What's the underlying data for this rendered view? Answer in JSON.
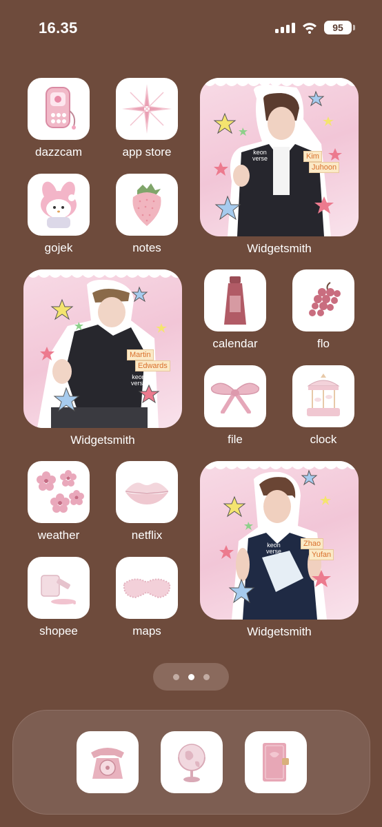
{
  "status": {
    "time": "16.35",
    "battery": "95"
  },
  "apps": {
    "dazzcam": "dazzcam",
    "app_store": "app store",
    "gojek": "gojek",
    "notes": "notes",
    "calendar": "calendar",
    "flo": "flo",
    "file": "file",
    "clock": "clock",
    "weather": "weather",
    "netflix": "netflix",
    "shopee": "shopee",
    "maps": "maps"
  },
  "widgets": [
    {
      "label": "Widgetsmith",
      "brand": [
        "keon",
        "verse"
      ],
      "tag1": "Kim",
      "tag2": "Juhoon"
    },
    {
      "label": "Widgetsmith",
      "brand": [
        "keon",
        "verse"
      ],
      "tag1": "Martin",
      "tag2": "Edwards"
    },
    {
      "label": "Widgetsmith",
      "brand": [
        "keon",
        "verse"
      ],
      "tag1": "Zhao",
      "tag2": "Yufan"
    }
  ],
  "dock": [
    "phone-icon",
    "globe-icon",
    "notebook-icon"
  ],
  "colors": {
    "background": "#6e4b3c",
    "dock": "#7d5e52",
    "pink": "#f2c6d7"
  }
}
